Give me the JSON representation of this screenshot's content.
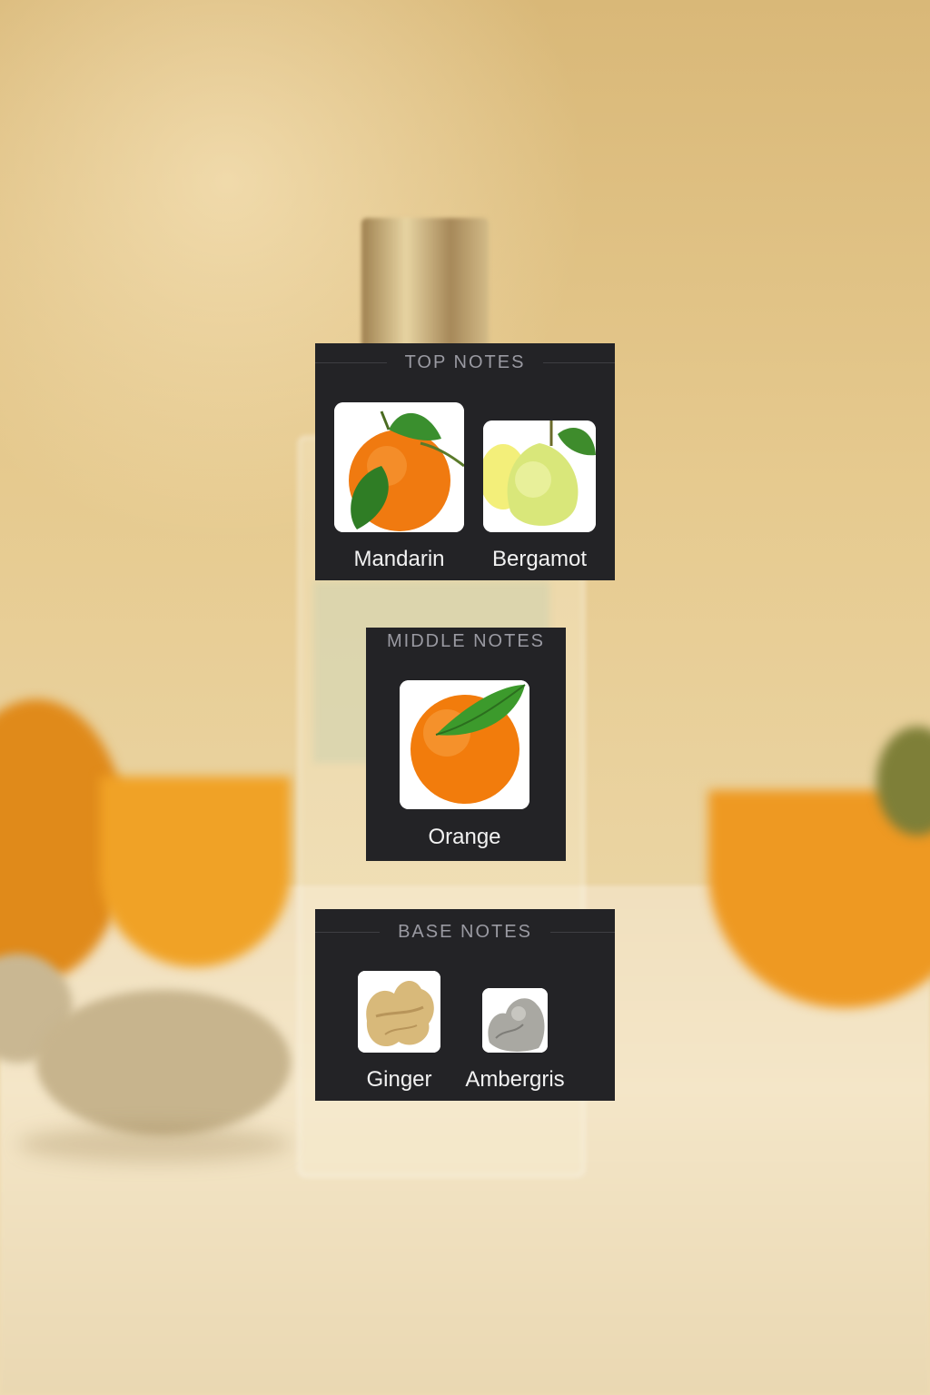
{
  "sections": {
    "top": {
      "title": "TOP NOTES",
      "notes": [
        {
          "label": "Mandarin",
          "icon": "mandarin-image"
        },
        {
          "label": "Bergamot",
          "icon": "bergamot-image"
        }
      ]
    },
    "middle": {
      "title": "MIDDLE NOTES",
      "notes": [
        {
          "label": "Orange",
          "icon": "orange-image"
        }
      ]
    },
    "base": {
      "title": "BASE NOTES",
      "notes": [
        {
          "label": "Ginger",
          "icon": "ginger-image"
        },
        {
          "label": "Ambergris",
          "icon": "ambergris-image"
        }
      ]
    }
  },
  "colors": {
    "card_background": "#232326",
    "heading_text": "#9a9aa2",
    "label_text": "#f2f2f2",
    "backdrop": "#e2c38a"
  }
}
